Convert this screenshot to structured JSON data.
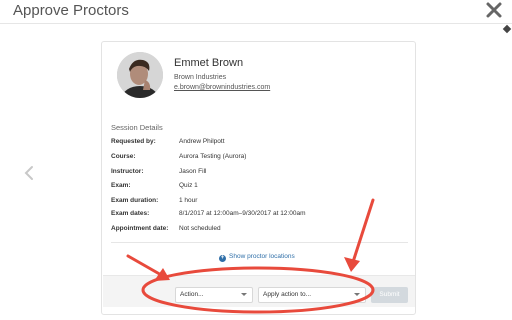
{
  "window": {
    "title": "Approve Proctors"
  },
  "proctor": {
    "name": "Emmet Brown",
    "organization": "Brown Industries",
    "email": "e.brown@brownindustries.com"
  },
  "session": {
    "heading": "Session Details",
    "rows": [
      {
        "label": "Requested by:",
        "value": "Andrew Philpott"
      },
      {
        "label": "Course:",
        "value": "Aurora Testing (Aurora)"
      },
      {
        "label": "Instructor:",
        "value": "Jason Fill"
      },
      {
        "label": "Exam:",
        "value": "Quiz 1"
      },
      {
        "label": "Exam duration:",
        "value": "1 hour"
      },
      {
        "label": "Exam dates:",
        "value": "8/1/2017 at 12:00am–9/30/2017 at 12:00am"
      },
      {
        "label": "Appointment date:",
        "value": "Not scheduled"
      }
    ],
    "show_locations_label": "Show proctor locations"
  },
  "footer": {
    "action_select_value": "Action...",
    "apply_select_value": "Apply action to...",
    "submit_label": "Submit"
  },
  "colors": {
    "link": "#2f6fa8",
    "annotation_red": "#e84a3c",
    "submit_disabled": "#d3d9de"
  },
  "icons": {
    "close": "close-icon",
    "previous": "chevron-left-icon",
    "add": "plus-circle-icon",
    "dropdown": "caret-down-icon"
  }
}
